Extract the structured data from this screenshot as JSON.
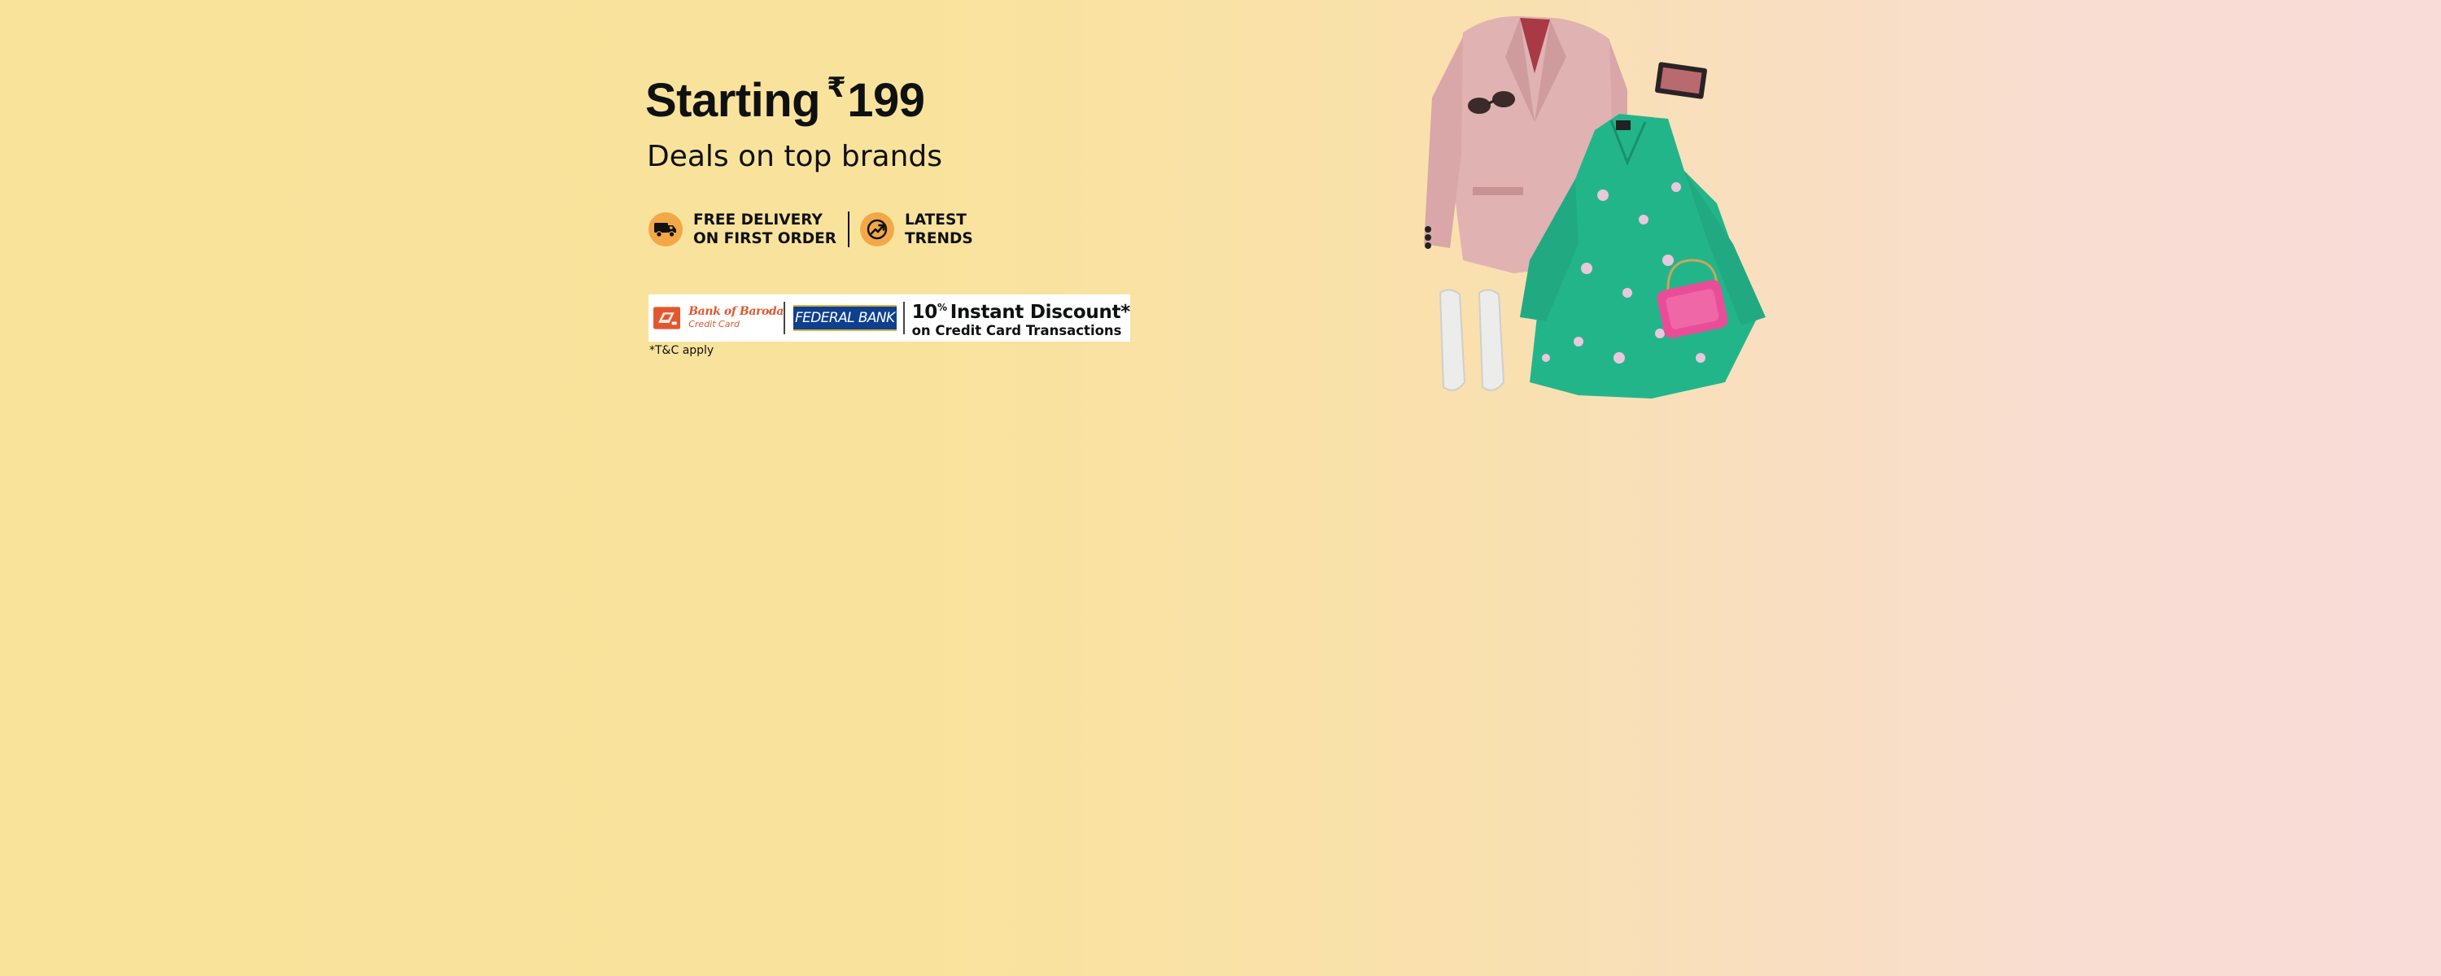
{
  "banner": {
    "headline": {
      "prefix": "Starting",
      "currency": "₹",
      "price": "199"
    },
    "subheading": "Deals on top brands",
    "features": [
      {
        "icon": "delivery-truck-icon",
        "lines": [
          "FREE DELIVERY",
          "ON FIRST ORDER"
        ]
      },
      {
        "icon": "trending-arrow-icon",
        "lines": [
          "LATEST",
          "TRENDS"
        ]
      }
    ],
    "offer": {
      "bank1_name": "Bank of Baroda",
      "bank1_sub": "Credit Card",
      "bank2_name": "FEDERAL BANK",
      "discount_value": "10",
      "discount_unit": "%",
      "discount_label": "Instant Discount*",
      "discount_sub": "on Credit Card Transactions"
    },
    "terms": "*T&C apply"
  },
  "colors": {
    "icon_circle": "#f3a847",
    "text_primary": "#0f1111",
    "bob_orange": "#e4572e",
    "federal_blue": "#0f3f8f"
  }
}
